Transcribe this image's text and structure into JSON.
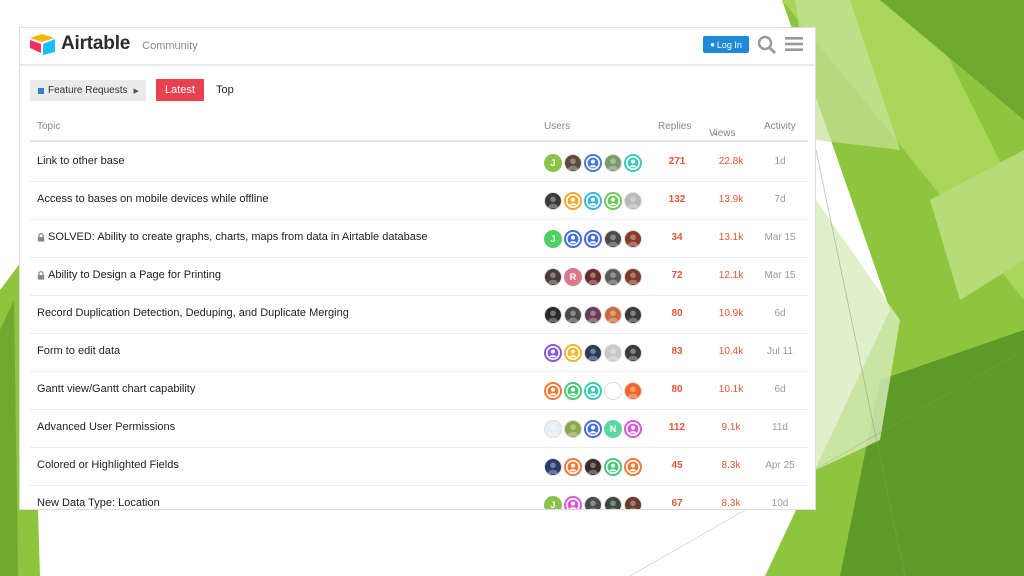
{
  "header": {
    "brand": "Airtable",
    "subtitle": "Community",
    "login_label": "Log In"
  },
  "nav": {
    "category": "Feature Requests",
    "tabs": [
      {
        "label": "Latest",
        "active": true
      },
      {
        "label": "Top",
        "active": false
      }
    ]
  },
  "table": {
    "columns": {
      "topic": "Topic",
      "users": "Users",
      "replies": "Replies",
      "views": "Views",
      "activity": "Activity"
    },
    "rows": [
      {
        "title": "Link to other base",
        "locked": false,
        "replies": "271",
        "views": "22.8k",
        "activity": "1d",
        "users": [
          {
            "kind": "letter",
            "text": "J",
            "color": "#8bc34a"
          },
          {
            "kind": "photo",
            "color": "#5a4a3a"
          },
          {
            "kind": "default",
            "color": "#4a7bd8"
          },
          {
            "kind": "photo",
            "color": "#7a9a6a"
          },
          {
            "kind": "default",
            "color": "#3fc8c0"
          }
        ]
      },
      {
        "title": "Access to bases on mobile devices while offline",
        "locked": false,
        "replies": "132",
        "views": "13.9k",
        "activity": "7d",
        "users": [
          {
            "kind": "photo",
            "color": "#3a3a3a"
          },
          {
            "kind": "default",
            "color": "#f0a930"
          },
          {
            "kind": "default",
            "color": "#3fb6d8"
          },
          {
            "kind": "default",
            "color": "#6cc85a"
          },
          {
            "kind": "photo",
            "color": "#b8b8b8"
          }
        ]
      },
      {
        "title": "SOLVED: Ability to create graphs, charts, maps from data in Airtable database",
        "locked": true,
        "replies": "34",
        "views": "13.1k",
        "activity": "Mar 15",
        "users": [
          {
            "kind": "letter",
            "text": "J",
            "color": "#4cd060"
          },
          {
            "kind": "default",
            "color": "#3f6fd8"
          },
          {
            "kind": "default",
            "color": "#4a6ad8"
          },
          {
            "kind": "photo",
            "color": "#4a4a4a"
          },
          {
            "kind": "photo",
            "color": "#8a3a2a"
          }
        ]
      },
      {
        "title": "Ability to Design a Page for Printing",
        "locked": true,
        "replies": "72",
        "views": "12.1k",
        "activity": "Mar 15",
        "users": [
          {
            "kind": "photo",
            "color": "#4a3a3a"
          },
          {
            "kind": "letter",
            "text": "R",
            "color": "#d87a8a"
          },
          {
            "kind": "photo",
            "color": "#6a2a2a"
          },
          {
            "kind": "photo",
            "color": "#5a5a5a"
          },
          {
            "kind": "photo",
            "color": "#7a3a2a"
          }
        ]
      },
      {
        "title": "Record Duplication Detection, Deduping, and Duplicate Merging",
        "locked": false,
        "replies": "80",
        "views": "10.9k",
        "activity": "6d",
        "users": [
          {
            "kind": "photo",
            "color": "#2a2a2a"
          },
          {
            "kind": "photo",
            "color": "#4a4a4a"
          },
          {
            "kind": "photo",
            "color": "#6a3a5a"
          },
          {
            "kind": "photo",
            "color": "#c86a3a"
          },
          {
            "kind": "photo",
            "color": "#3a3a3a"
          }
        ]
      },
      {
        "title": "Form to edit data",
        "locked": false,
        "replies": "83",
        "views": "10.4k",
        "activity": "Jul 11",
        "users": [
          {
            "kind": "default",
            "color": "#8a5ad8"
          },
          {
            "kind": "default",
            "color": "#f0b830"
          },
          {
            "kind": "photo",
            "color": "#2a3a5a"
          },
          {
            "kind": "photo",
            "color": "#c8c8c8"
          },
          {
            "kind": "photo",
            "color": "#3a3a3a"
          }
        ]
      },
      {
        "title": "Gantt view/Gantt chart capability",
        "locked": false,
        "replies": "80",
        "views": "10.1k",
        "activity": "6d",
        "users": [
          {
            "kind": "default",
            "color": "#f07a3a"
          },
          {
            "kind": "default",
            "color": "#4ac878"
          },
          {
            "kind": "default",
            "color": "#3ac8b8"
          },
          {
            "kind": "photo",
            "color": "#ffffff"
          },
          {
            "kind": "photo",
            "color": "#f0662a"
          }
        ]
      },
      {
        "title": "Advanced User Permissions",
        "locked": false,
        "replies": "112",
        "views": "9.1k",
        "activity": "11d",
        "users": [
          {
            "kind": "photo",
            "color": "#e8eef4"
          },
          {
            "kind": "photo",
            "color": "#8aa84a"
          },
          {
            "kind": "default",
            "color": "#4a6ad8"
          },
          {
            "kind": "letter",
            "text": "N",
            "color": "#5ad8a0"
          },
          {
            "kind": "default",
            "color": "#d85ad8"
          }
        ]
      },
      {
        "title": "Colored or Highlighted Fields",
        "locked": false,
        "replies": "45",
        "views": "8.3k",
        "activity": "Apr 25",
        "users": [
          {
            "kind": "photo",
            "color": "#2a3a6a"
          },
          {
            "kind": "default",
            "color": "#f07a3a"
          },
          {
            "kind": "photo",
            "color": "#3a2a2a"
          },
          {
            "kind": "default",
            "color": "#4ac878"
          },
          {
            "kind": "default",
            "color": "#f07a3a"
          }
        ]
      },
      {
        "title": "New Data Type: Location",
        "locked": false,
        "replies": "67",
        "views": "8.3k",
        "activity": "10d",
        "users": [
          {
            "kind": "letter",
            "text": "J",
            "color": "#8bc34a"
          },
          {
            "kind": "default",
            "color": "#d85ad8"
          },
          {
            "kind": "photo",
            "color": "#4a4a4a"
          },
          {
            "kind": "photo",
            "color": "#3a4a3a"
          },
          {
            "kind": "photo",
            "color": "#6a3a2a"
          }
        ]
      }
    ]
  },
  "colors": {
    "accent": "#e8414f",
    "login": "#1f8ad8",
    "numbers": "#e45735",
    "slide_green": "#8bc34a"
  }
}
